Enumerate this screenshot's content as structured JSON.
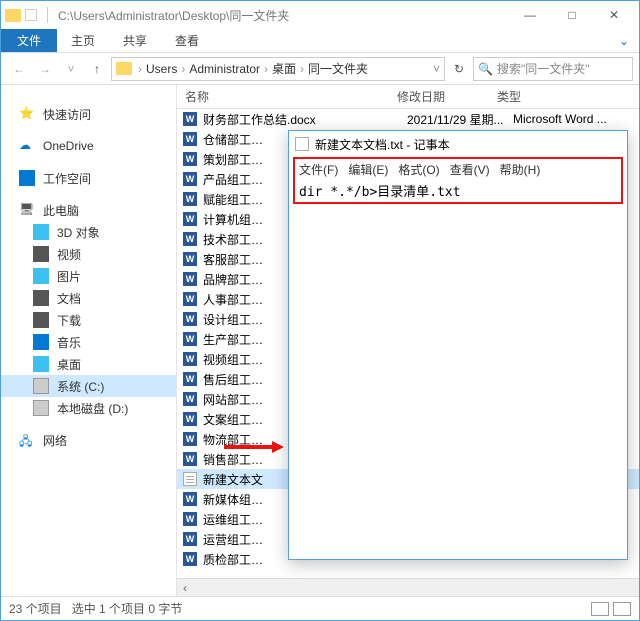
{
  "titlebar": {
    "path": "C:\\Users\\Administrator\\Desktop\\同一文件夹",
    "min": "—",
    "max": "□",
    "close": "✕"
  },
  "ribbon": {
    "file": "文件",
    "home": "主页",
    "share": "共享",
    "view": "查看",
    "chev": "⌄"
  },
  "nav": {
    "back": "←",
    "fwd": "→",
    "up": "↑",
    "dd": "˅",
    "refresh": "↻"
  },
  "breadcrumb": {
    "sep": "›",
    "items": [
      "Users",
      "Administrator",
      "桌面",
      "同一文件夹"
    ],
    "refresh_sep": "˅"
  },
  "search": {
    "icon": "🔍",
    "placeholder": "搜索\"同一文件夹\""
  },
  "sidebar": {
    "items": [
      {
        "icon": "⭐",
        "cls": "ico-star",
        "label": "快速访问"
      },
      {
        "icon": "☁",
        "cls": "ico-cloud",
        "label": "OneDrive"
      },
      {
        "icon": "",
        "cls": "ico-work",
        "label": "工作空间"
      },
      {
        "icon": "🖥",
        "cls": "ico-pc",
        "label": "此电脑"
      },
      {
        "icon": "",
        "cls": "ico-3d",
        "label": "3D 对象"
      },
      {
        "icon": "",
        "cls": "ico-video",
        "label": "视频"
      },
      {
        "icon": "",
        "cls": "ico-pic",
        "label": "图片"
      },
      {
        "icon": "",
        "cls": "ico-doc",
        "label": "文档"
      },
      {
        "icon": "",
        "cls": "ico-dl",
        "label": "下载"
      },
      {
        "icon": "",
        "cls": "ico-music",
        "label": "音乐"
      },
      {
        "icon": "",
        "cls": "ico-desk",
        "label": "桌面"
      },
      {
        "icon": "",
        "cls": "ico-drive",
        "label": "系统 (C:)",
        "selected": true
      },
      {
        "icon": "",
        "cls": "ico-drive",
        "label": "本地磁盘 (D:)"
      },
      {
        "icon": "🖧",
        "cls": "ico-net",
        "label": "网络"
      }
    ]
  },
  "columns": {
    "name": "名称",
    "date": "修改日期",
    "type": "类型"
  },
  "files": [
    {
      "icon": "W",
      "type": "word",
      "name": "财务部工作总结.docx",
      "date": "2021/11/29 星期...",
      "ftype": "Microsoft Word ..."
    },
    {
      "icon": "W",
      "type": "word",
      "name": "仓储部工作总结"
    },
    {
      "icon": "W",
      "type": "word",
      "name": "策划部工作总结"
    },
    {
      "icon": "W",
      "type": "word",
      "name": "产品组工作总结"
    },
    {
      "icon": "W",
      "type": "word",
      "name": "赋能组工作总结"
    },
    {
      "icon": "W",
      "type": "word",
      "name": "计算机组工作总"
    },
    {
      "icon": "W",
      "type": "word",
      "name": "技术部工作总结"
    },
    {
      "icon": "W",
      "type": "word",
      "name": "客服部工作总结"
    },
    {
      "icon": "W",
      "type": "word",
      "name": "品牌部工作总结"
    },
    {
      "icon": "W",
      "type": "word",
      "name": "人事部工作总结"
    },
    {
      "icon": "W",
      "type": "word",
      "name": "设计组工作总结"
    },
    {
      "icon": "W",
      "type": "word",
      "name": "生产部工作总结"
    },
    {
      "icon": "W",
      "type": "word",
      "name": "视频组工作总结"
    },
    {
      "icon": "W",
      "type": "word",
      "name": "售后组工作总结"
    },
    {
      "icon": "W",
      "type": "word",
      "name": "网站部工作总结"
    },
    {
      "icon": "W",
      "type": "word",
      "name": "文案组工作总结"
    },
    {
      "icon": "W",
      "type": "word",
      "name": "物流部工作总结"
    },
    {
      "icon": "W",
      "type": "word",
      "name": "销售部工作总结"
    },
    {
      "icon": "",
      "type": "txt",
      "name": "新建文本文",
      "selected": true
    },
    {
      "icon": "W",
      "type": "word",
      "name": "新媒体组工作总"
    },
    {
      "icon": "W",
      "type": "word",
      "name": "运维组工作总结"
    },
    {
      "icon": "W",
      "type": "word",
      "name": "运营组工作总结"
    },
    {
      "icon": "W",
      "type": "word",
      "name": "质检部工作总结"
    }
  ],
  "status": {
    "count": "23 个项目",
    "sel": "选中 1 个项目 0 字节"
  },
  "scroll": {
    "left": "‹"
  },
  "notepad": {
    "title": "新建文本文档.txt - 记事本",
    "menu": {
      "file": "文件(F)",
      "edit": "编辑(E)",
      "format": "格式(O)",
      "view": "查看(V)",
      "help": "帮助(H)"
    },
    "content": "dir *.*/b>目录清单.txt"
  }
}
